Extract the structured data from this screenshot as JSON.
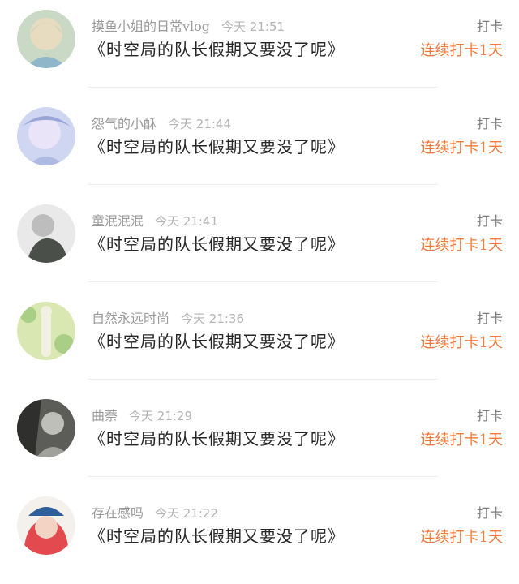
{
  "items": [
    {
      "username": "摸鱼小姐的日常vlog",
      "time": "今天 21:51",
      "title": "《时空局的队长假期又要没了呢》",
      "checkin_label": "打卡",
      "streak": "连续打卡1天",
      "avatar_icon": "anime-girl-avatar",
      "avatar_colors": [
        "#c9d9c6",
        "#e8dcc0",
        "#8fb7c9"
      ]
    },
    {
      "username": "怨气的小酥",
      "time": "今天 21:44",
      "title": "《时空局的队长假期又要没了呢》",
      "checkin_label": "打卡",
      "streak": "连续打卡1天",
      "avatar_icon": "anime-girl-avatar",
      "avatar_colors": [
        "#cfd6f2",
        "#e9e4f7",
        "#9aa6d8"
      ]
    },
    {
      "username": "童泯泯泯",
      "time": "今天 21:41",
      "title": "《时空局的队长假期又要没了呢》",
      "checkin_label": "打卡",
      "streak": "连续打卡1天",
      "avatar_icon": "sketch-character-avatar",
      "avatar_colors": [
        "#e9e9e9",
        "#bdbdbd",
        "#4a4f4a"
      ]
    },
    {
      "username": "自然永远时尚",
      "time": "今天 21:36",
      "title": "《时空局的队长假期又要没了呢》",
      "checkin_label": "打卡",
      "streak": "连续打卡1天",
      "avatar_icon": "skeleton-flowers-avatar",
      "avatar_colors": [
        "#d9e8b2",
        "#a9cf86",
        "#f2f0e0"
      ]
    },
    {
      "username": "曲萘",
      "time": "今天 21:29",
      "title": "《时空局的队长假期又要没了呢》",
      "checkin_label": "打卡",
      "streak": "连续打卡1天",
      "avatar_icon": "dark-portrait-avatar",
      "avatar_colors": [
        "#5c5c58",
        "#2f302e",
        "#bfbfb9"
      ]
    },
    {
      "username": "存在感吗",
      "time": "今天 21:22",
      "title": "《时空局的队长假期又要没了呢》",
      "checkin_label": "打卡",
      "streak": "连续打卡1天",
      "avatar_icon": "anime-girl-hat-avatar",
      "avatar_colors": [
        "#e24a4f",
        "#f3d3c4",
        "#2f5f9a"
      ]
    }
  ]
}
